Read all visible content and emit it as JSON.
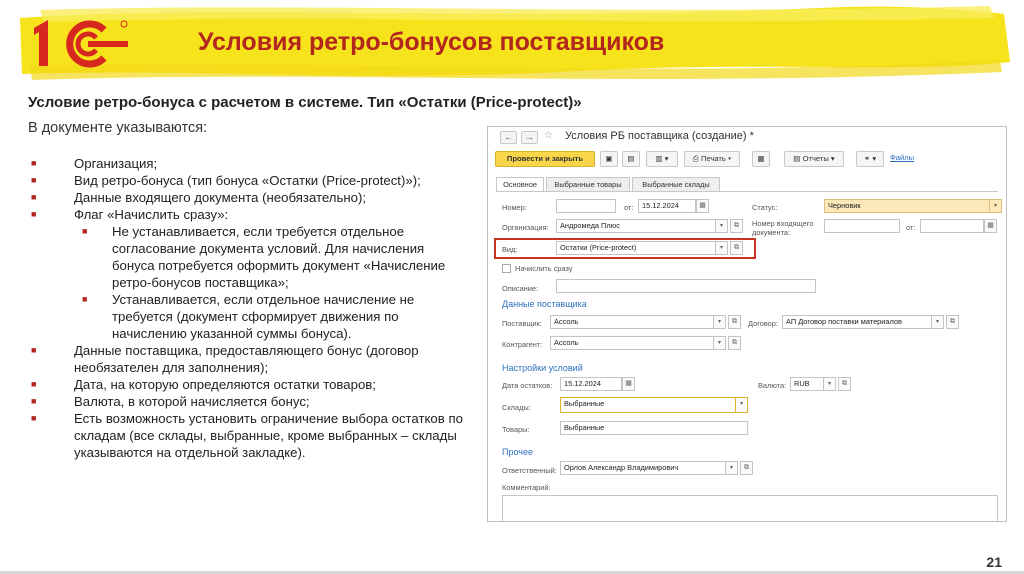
{
  "slide": {
    "title": "Условия ретро-бонусов поставщиков",
    "subtitle": "Условие ретро-бонуса с расчетом в системе. Тип «Остатки (Price-protect)»",
    "intro": "В документе указываются:",
    "bullet_marker": "■",
    "bullets": [
      "Организация;",
      "Вид ретро-бонуса (тип бонуса «Остатки (Price-protect)»);",
      "Данные входящего документа (необязательно);",
      "Флаг «Начислить сразу»:",
      "Данные поставщика, предоставляющего бонус (договор необязателен для заполнения);",
      "Дата, на которую определяются остатки товаров;",
      "Валюта, в которой начисляется бонус;",
      "Есть возможность установить ограничение выбора остатков по складам (все склады, выбранные, кроме выбранных – склады указываются на отдельной закладке)."
    ],
    "sub_bullets": [
      "Не устанавливается, если требуется отдельное согласование документа условий. Для начисления бонуса потребуется оформить документ «Начисление ретро-бонусов поставщика»;",
      "Устанавливается, если отдельное начисление не требуется (документ сформирует движения по начислению указанной суммы бонуса)."
    ],
    "page_number": "21",
    "accent_color": "#b3261e",
    "banner_color": "#f6e31b"
  },
  "form": {
    "title": "Условия РБ поставщика (создание) *",
    "nav_back": "←",
    "nav_forward": "→",
    "link_icon": "☆",
    "toolbar": {
      "post_close": "Провести и закрыть",
      "print": "Печать",
      "reports": "Отчеты",
      "files": "Файлы"
    },
    "tabs": [
      "Основное",
      "Выбранные товары",
      "Выбранные склады"
    ],
    "labels": {
      "number": "Номер:",
      "from": "от:",
      "status": "Статус:",
      "organization": "Организация:",
      "incoming_number": "Номер входящего документа:",
      "from2": "от:",
      "kind": "Вид:",
      "accrue_now": "Начислить сразу",
      "description": "Описание:",
      "supplier": "Поставщик:",
      "contract": "Договор:",
      "counterparty": "Контрагент:",
      "stock_date": "Дата остатков:",
      "currency": "Валюта:",
      "warehouses": "Склады:",
      "goods": "Товары:",
      "responsible": "Ответственный:",
      "comment": "Комментарий:"
    },
    "sections": {
      "supplier_data": "Данные поставщика",
      "conditions": "Настройки условий",
      "other": "Прочее"
    },
    "values": {
      "date": "15.12.2024",
      "status": "Черновик",
      "organization": "Андромеда Плюс",
      "kind": "Остатки (Price-protect)",
      "supplier": "Ассоль",
      "contract": "АП Договор поставки материалов",
      "counterparty": "Ассоль",
      "stock_date": "15.12.2024",
      "currency": "RUB",
      "warehouses": "Выбранные",
      "goods": "Выбранные",
      "responsible": "Орлов Александр Владимирович"
    },
    "glyphs": {
      "dropdown": "▾",
      "open": "⧉",
      "calendar": "▦"
    }
  }
}
